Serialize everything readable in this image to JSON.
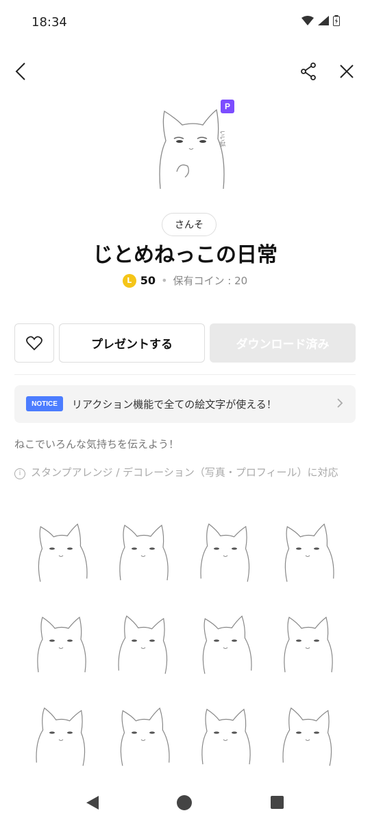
{
  "status_bar": {
    "time": "18:34",
    "icons": [
      "wifi-icon",
      "signal-icon",
      "battery-icon"
    ]
  },
  "header": {
    "icons": [
      "back-arrow-icon",
      "share-icon",
      "close-icon"
    ]
  },
  "pack": {
    "badge": "P",
    "author": "さんそ",
    "title": "じとめねっこの日常",
    "coin_icon_letter": "L",
    "price": "50",
    "separator": "•",
    "owned_coins": "保有コイン : 20"
  },
  "actions": {
    "favorite_icon": "heart-icon",
    "gift_label": "プレゼントする",
    "download_label": "ダウンロード済み"
  },
  "notice": {
    "tag": "NOTICE",
    "text": "リアクション機能で全ての絵文字が使える！"
  },
  "description": "ねこでいろんな気持ちを伝えよう！",
  "arrange_info": {
    "icon": "i",
    "text": "スタンプアレンジ / デコレーション（写真・プロフィール）に対応"
  },
  "stickers": [
    {
      "icon": "cat-sticker-icon"
    },
    {
      "icon": "cat-sticker-icon"
    },
    {
      "icon": "cat-sticker-icon"
    },
    {
      "icon": "cat-sticker-icon"
    },
    {
      "icon": "cat-sticker-icon"
    },
    {
      "icon": "cat-sticker-icon"
    },
    {
      "icon": "cat-sticker-icon"
    },
    {
      "icon": "cat-sticker-icon"
    },
    {
      "icon": "cat-sticker-icon"
    },
    {
      "icon": "cat-sticker-icon"
    },
    {
      "icon": "cat-sticker-icon"
    },
    {
      "icon": "cat-sticker-icon"
    }
  ],
  "colors": {
    "premium": "#7c4dff",
    "notice_tag": "#4c7dff",
    "coin": "#f5c518",
    "download_disabled": "#e9e9e9"
  }
}
